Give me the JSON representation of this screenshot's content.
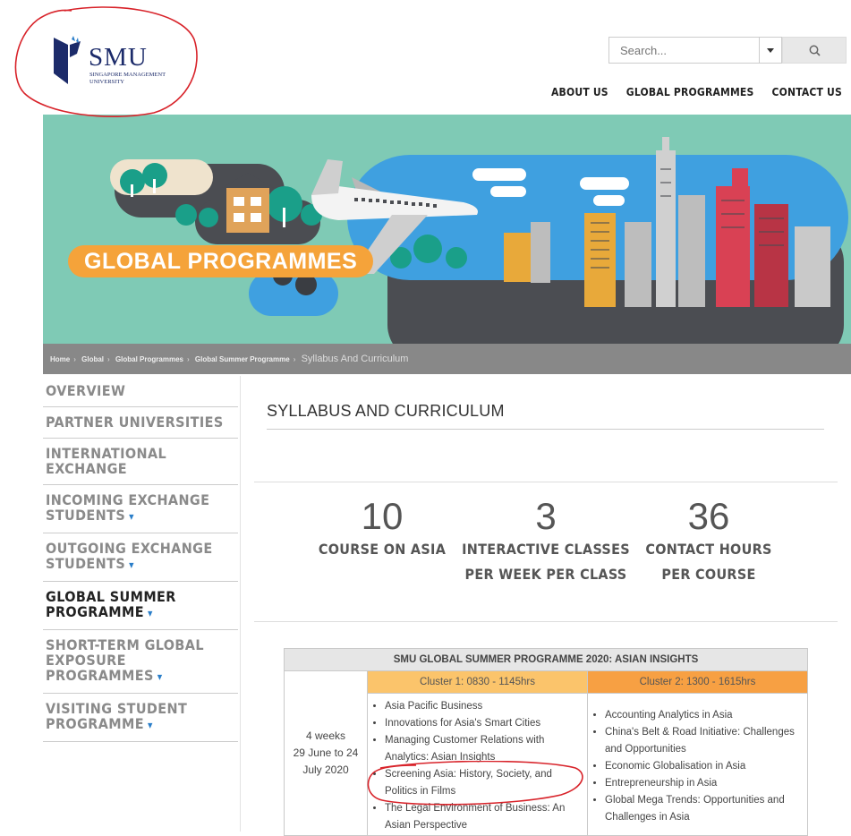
{
  "header": {
    "logo": {
      "name": "SMU",
      "sub_line1": "SINGAPORE MANAGEMENT",
      "sub_line2": "UNIVERSITY"
    },
    "search": {
      "placeholder": "Search..."
    },
    "nav": [
      "ABOUT US",
      "GLOBAL PROGRAMMES",
      "CONTACT US"
    ]
  },
  "banner": {
    "title": "GLOBAL PROGRAMMES"
  },
  "breadcrumb": {
    "items": [
      "Home",
      "Global",
      "Global Programmes",
      "Global Summer Programme"
    ],
    "current": "Syllabus And Curriculum"
  },
  "sidebar": {
    "items": [
      {
        "line1": "OVERVIEW",
        "line2": ""
      },
      {
        "line1": "PARTNER UNIVERSITIES",
        "line2": ""
      },
      {
        "line1": "INTERNATIONAL EXCHANGE",
        "line2": ""
      },
      {
        "line1": "INCOMING EXCHANGE",
        "line2": "STUDENTS"
      },
      {
        "line1": "OUTGOING EXCHANGE",
        "line2": "STUDENTS"
      },
      {
        "line1": "GLOBAL SUMMER",
        "line2": "PROGRAMME"
      },
      {
        "line1": "SHORT-TERM GLOBAL",
        "line2": "EXPOSURE PROGRAMMES"
      },
      {
        "line1": "VISITING STUDENT",
        "line2": "PROGRAMME"
      }
    ]
  },
  "main": {
    "title": "SYLLABUS AND CURRICULUM",
    "stats": [
      {
        "number": "10",
        "label1": "COURSE ON ASIA",
        "label2": ""
      },
      {
        "number": "3",
        "label1": "INTERACTIVE CLASSES",
        "label2": "PER WEEK PER CLASS"
      },
      {
        "number": "36",
        "label1": "CONTACT HOURS",
        "label2": "PER COURSE"
      }
    ],
    "table": {
      "title": "SMU GLOBAL SUMMER PROGRAMME 2020: ASIAN INSIGHTS",
      "cluster1": "Cluster 1: 0830 - 1145hrs",
      "cluster2": "Cluster 2: 1300 - 1615hrs",
      "date_line1": "4 weeks",
      "date_line2": "29 June to 24",
      "date_line3": "July 2020",
      "cluster1_courses": [
        "Asia Pacific Business",
        "Innovations for Asia's Smart Cities",
        "Managing Customer Relations with Analytics: Asian Insights",
        "Screening Asia: History, Society, and Politics in Films",
        "The Legal Environment of Business: An Asian Perspective"
      ],
      "cluster2_courses": [
        "Accounting Analytics in Asia",
        "China's Belt & Road Initiative: Challenges and Opportunities",
        "Economic Globalisation in Asia",
        "Entrepreneurship in Asia",
        "Global Mega Trends: Opportunities and Challenges in Asia"
      ]
    }
  },
  "colors": {
    "banner_bg": "#7fcab5",
    "banner_title_bg": "#f5a33a",
    "cluster1": "#fbc46b",
    "cluster2": "#f7a043",
    "annotation": "#d8232a",
    "caret": "#2a7ec9"
  },
  "icons": {
    "search": "search-icon",
    "dropdown": "chevron-down-icon",
    "logo_mark": "smu-logo-icon"
  }
}
